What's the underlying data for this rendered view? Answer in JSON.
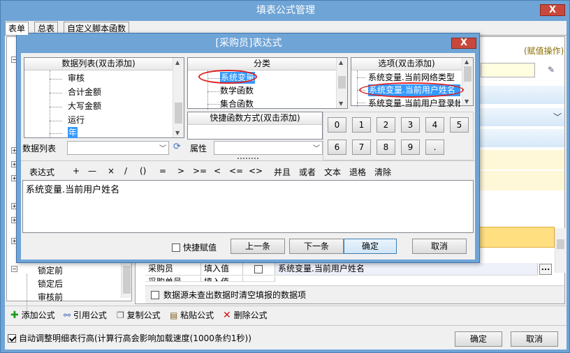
{
  "window": {
    "title": "填表公式管理",
    "close": "X"
  },
  "tabs": [
    "表单",
    "总表",
    "自定义脚本函数"
  ],
  "right_panel": {
    "assign_op": "(赋值操作)"
  },
  "tree_items": [
    "锁定前",
    "锁定后",
    "审核前"
  ],
  "grid_row": {
    "name": "采购员",
    "type": "填入值",
    "value": "系统变量.当前用户姓名",
    "ellipsis": "..."
  },
  "grid_row2": {
    "name": "采购单号",
    "type": "填入值"
  },
  "clear_option": "数据源未查出数据时清空填报的数据项",
  "toolbar": {
    "add": "添加公式",
    "ref": "引用公式",
    "copy": "复制公式",
    "paste": "粘贴公式",
    "delete": "删除公式"
  },
  "auto_adjust": "自动调整明细表行高(计算行高会影响加载速度(1000条约1秒))",
  "main_buttons": {
    "ok": "确定",
    "cancel": "取消"
  },
  "dialog": {
    "title": "[采购员]表达式",
    "close": "X",
    "data_list": {
      "header": "数据列表(双击添加)",
      "items": [
        "审核",
        "合计金额",
        "大写金额",
        "运行",
        "年"
      ]
    },
    "category": {
      "header": "分类",
      "items": [
        "系统变量",
        "数学函数",
        "集合函数"
      ]
    },
    "options": {
      "header": "选项(双击添加)",
      "items": [
        "系统变量.当前网络类型",
        "系统变量.当前用户姓名",
        "系统变量.当前用户登录帐"
      ]
    },
    "shortcut_header": "快捷函数方式(双击添加)",
    "data_list_label": "数据列表",
    "property_label": "属性",
    "numpad": [
      "0",
      "1",
      "2",
      "3",
      "4",
      "5",
      "6",
      "7",
      "8",
      "9",
      "."
    ],
    "expr_label": "表达式",
    "operators": [
      "+",
      "—",
      "×",
      "/",
      "()",
      "=",
      ">",
      ">=",
      "<",
      "<=",
      "<>",
      "并且",
      "或者",
      "文本",
      "退格",
      "清除"
    ],
    "expression": "系统变量.当前用户姓名",
    "quick_assign": "快捷赋值",
    "prev": "上一条",
    "next": "下一条",
    "ok": "确定",
    "cancel": "取消"
  }
}
